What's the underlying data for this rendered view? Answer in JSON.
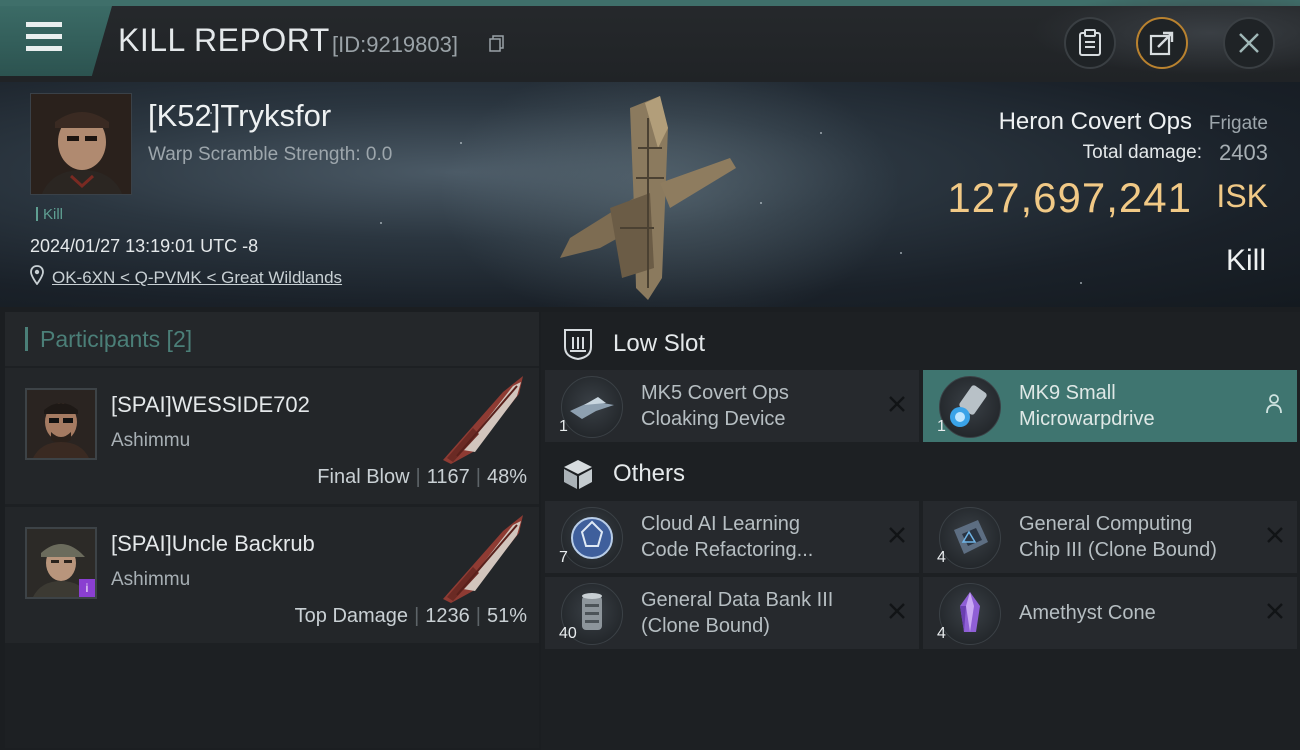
{
  "header": {
    "title": "KILL REPORT",
    "report_id": "[ID:9219803]"
  },
  "victim": {
    "name": "[K52]Tryksfor",
    "warp_scramble": "Warp Scramble Strength: 0.0",
    "tag": "Kill",
    "datetime": "2024/01/27 13:19:01 UTC -8",
    "location": "OK-6XN < Q-PVMK < Great Wildlands",
    "ship_name": "Heron Covert Ops",
    "ship_class": "Frigate",
    "total_damage_label": "Total damage:",
    "total_damage": "2403",
    "isk_value": "127,697,241",
    "isk_unit": "ISK",
    "result": "Kill"
  },
  "participants": {
    "title": "Participants [2]",
    "rows": [
      {
        "name": "[SPAI]WESSIDE702",
        "ship": "Ashimmu",
        "role": "Final Blow",
        "damage": "1167",
        "percent": "48%"
      },
      {
        "name": "[SPAI]Uncle Backrub",
        "ship": "Ashimmu",
        "role": "Top Damage",
        "damage": "1236",
        "percent": "51%"
      }
    ]
  },
  "sections": {
    "low_slot": {
      "title": "Low Slot",
      "items": [
        {
          "qty": "1",
          "line1": "MK5 Covert Ops",
          "line2": "Cloaking Device"
        },
        {
          "qty": "1",
          "line1": "MK9 Small",
          "line2": "Microwarpdrive"
        }
      ]
    },
    "others": {
      "title": "Others",
      "items": [
        {
          "qty": "7",
          "line1": "Cloud AI Learning",
          "line2": "Code Refactoring..."
        },
        {
          "qty": "4",
          "line1": "General Computing",
          "line2": "Chip III (Clone Bound)"
        },
        {
          "qty": "40",
          "line1": "General Data Bank III",
          "line2": "(Clone Bound)"
        },
        {
          "qty": "4",
          "line1": "Amethyst Cone",
          "line2": ""
        }
      ]
    }
  },
  "colors": {
    "accent_teal": "#3f7570",
    "isk_gold": "#f1c986",
    "close_orange": "#b9822f"
  }
}
